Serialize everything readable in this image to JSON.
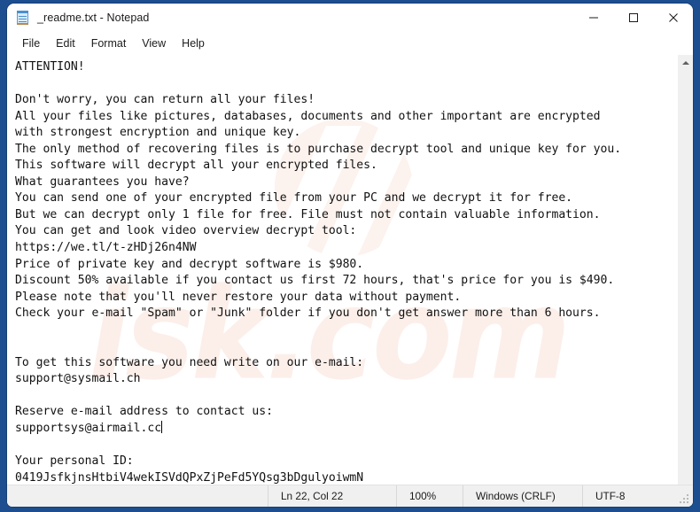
{
  "window": {
    "title": "_readme.txt - Notepad",
    "icon": "notepad-icon",
    "minimize_label": "—",
    "maximize_label": "□",
    "close_label": "✕"
  },
  "menubar": {
    "items": [
      {
        "label": "File"
      },
      {
        "label": "Edit"
      },
      {
        "label": "Format"
      },
      {
        "label": "View"
      },
      {
        "label": "Help"
      }
    ]
  },
  "editor": {
    "content": "ATTENTION!\n\nDon't worry, you can return all your files!\nAll your files like pictures, databases, documents and other important are encrypted\nwith strongest encryption and unique key.\nThe only method of recovering files is to purchase decrypt tool and unique key for you.\nThis software will decrypt all your encrypted files.\nWhat guarantees you have?\nYou can send one of your encrypted file from your PC and we decrypt it for free.\nBut we can decrypt only 1 file for free. File must not contain valuable information.\nYou can get and look video overview decrypt tool:\nhttps://we.tl/t-zHDj26n4NW\nPrice of private key and decrypt software is $980.\nDiscount 50% available if you contact us first 72 hours, that's price for you is $490.\nPlease note that you'll never restore your data without payment.\nCheck your e-mail \"Spam\" or \"Junk\" folder if you don't get answer more than 6 hours.\n\n\nTo get this software you need write on our e-mail:\nsupport@sysmail.ch\n\nReserve e-mail address to contact us:\nsupportsys@airmail.cc",
    "content_after_caret": "\n\nYour personal ID:\n0419JsfkjnsHtbiV4wekISVdQPxZjPeFd5YQsg3bDgulyoiwmN",
    "ransom_note": {
      "headline": "ATTENTION!",
      "download_url": "https://we.tl/t-zHDj26n4NW",
      "price_full": "$980",
      "price_discount": "$490",
      "discount_percent": "50%",
      "discount_window_hours": "72 hours",
      "response_time": "6 hours",
      "primary_email": "support@sysmail.ch",
      "reserve_email": "supportsys@airmail.cc",
      "personal_id": "0419JsfkjnsHtbiV4wekISVdQPxZjPeFd5YQsg3bDgulyoiwmN"
    },
    "watermark_text": "isk.com"
  },
  "statusbar": {
    "cursor_position": "Ln 22, Col 22",
    "zoom": "100%",
    "line_ending": "Windows (CRLF)",
    "encoding": "UTF-8"
  },
  "colors": {
    "desktop": "#1d4e8f",
    "window_bg": "#ffffff",
    "statusbar_bg": "#f0f0f0",
    "scrollbar_bg": "#f0f0f0",
    "text": "#111111",
    "watermark": "#eca082"
  }
}
